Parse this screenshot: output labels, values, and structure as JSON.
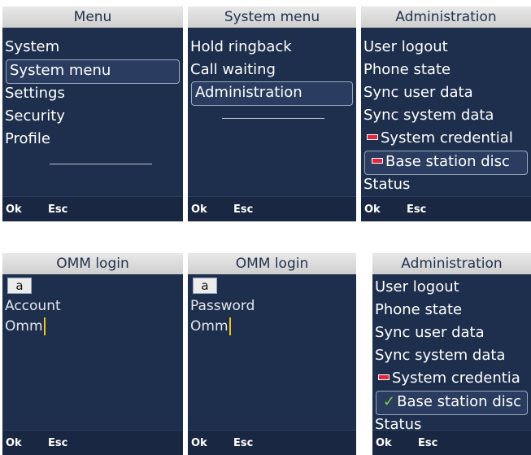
{
  "softkeys": {
    "ok": "Ok",
    "esc": "Esc"
  },
  "menu": {
    "title": "Menu",
    "items": [
      "System",
      "System menu",
      "Settings",
      "Security",
      "Profile"
    ]
  },
  "system_menu": {
    "title": "System menu",
    "items": [
      "Hold ringback",
      "Call waiting",
      "Administration"
    ]
  },
  "administration": {
    "title": "Administration",
    "items": [
      "User logout",
      "Phone state",
      "Sync user data",
      "Sync system data",
      "System credential",
      "Base station disc",
      "Status"
    ]
  },
  "omm_login_account": {
    "title": "OMM login",
    "input_mode": "a",
    "label": "Account",
    "value": "Omm"
  },
  "omm_login_password": {
    "title": "OMM login",
    "input_mode": "a",
    "label": "Password",
    "value": "Omm"
  },
  "administration_after": {
    "title": "Administration",
    "items": [
      "User logout",
      "Phone state",
      "Sync user data",
      "Sync system data",
      "System credentia",
      "Base station disc",
      "Status"
    ]
  }
}
